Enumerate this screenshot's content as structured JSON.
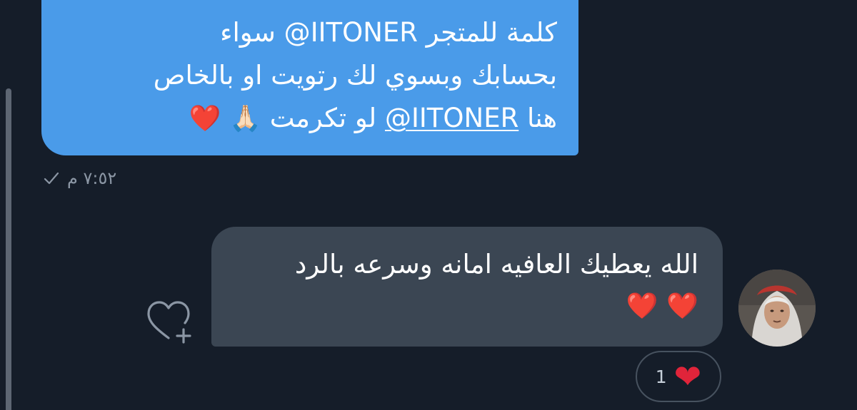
{
  "sent_message": {
    "line1": "كلمة للمتجر  IITONER@ سواء",
    "line2": "بحسابك وبسوي لك رتويت او بالخاص",
    "line3_prefix": "هنا ",
    "line3_mention": "IITONER@",
    "line3_suffix": " لو تكرمت ",
    "emoji_pray": "🙏🏻",
    "emoji_heart": "❤️",
    "timestamp": "٧:٥٢ م"
  },
  "received_message": {
    "line1": "الله يعطيك العافيه امانه وسرعه بالرد",
    "heart1": "❤️",
    "heart2": "❤️"
  },
  "reaction": {
    "count": "1",
    "emoji": "❤"
  },
  "icons": {
    "check": "check-icon",
    "add_reaction": "heart-plus-icon",
    "avatar": "avatar"
  },
  "colors": {
    "background": "#151d29",
    "sent_bubble": "#4a9be9",
    "received_bubble": "#3b4653",
    "heart": "#e0243a"
  }
}
